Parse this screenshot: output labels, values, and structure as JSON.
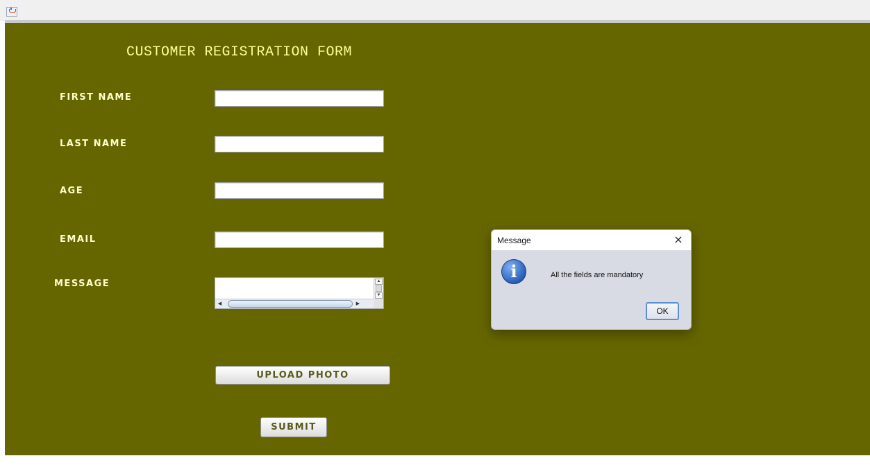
{
  "window": {
    "icon": "java-app-icon"
  },
  "form": {
    "title": "CUSTOMER REGISTRATION FORM",
    "fields": [
      {
        "label": "FIRST NAME",
        "value": ""
      },
      {
        "label": "LAST NAME",
        "value": ""
      },
      {
        "label": "AGE",
        "value": ""
      },
      {
        "label": "EMAIL",
        "value": ""
      },
      {
        "label": "MESSAGE",
        "value": ""
      }
    ],
    "upload_button": "UPLOAD PHOTO",
    "submit_button": "SUBMIT"
  },
  "dialog": {
    "title": "Message",
    "close": "×",
    "icon": "information-icon",
    "icon_glyph": "i",
    "message": "All the fields are mandatory",
    "ok_button": "OK"
  },
  "colors": {
    "panel_background": "#666600",
    "title_text": "#ffff99",
    "label_text": "#ffffcc",
    "dialog_background": "#d8dbe3",
    "ok_button_border": "#5a8fd8"
  }
}
